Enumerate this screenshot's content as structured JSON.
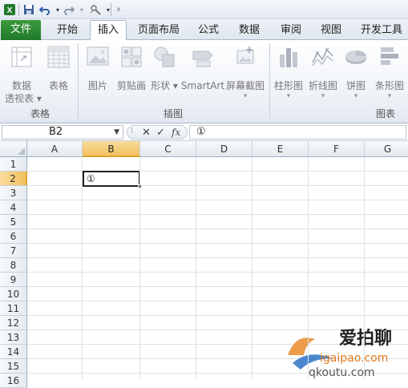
{
  "quick_access": {
    "items": [
      "excel-logo",
      "save-icon",
      "undo-icon",
      "redo-icon",
      "customize-icon"
    ]
  },
  "tabs": [
    {
      "label": "文件",
      "kind": "file"
    },
    {
      "label": "开始"
    },
    {
      "label": "插入",
      "active": true
    },
    {
      "label": "页面布局"
    },
    {
      "label": "公式"
    },
    {
      "label": "数据"
    },
    {
      "label": "审阅"
    },
    {
      "label": "视图"
    },
    {
      "label": "开发工具"
    }
  ],
  "ribbon": {
    "groups": [
      {
        "label": "表格",
        "buttons": [
          {
            "label": "数据\n透视表",
            "icon": "pivot-table-icon",
            "dropdown": true
          },
          {
            "label": "表格",
            "icon": "table-icon"
          }
        ]
      },
      {
        "label": "插图",
        "buttons": [
          {
            "label": "图片",
            "icon": "picture-icon"
          },
          {
            "label": "剪贴画",
            "icon": "clipart-icon"
          },
          {
            "label": "形状",
            "icon": "shapes-icon",
            "dropdown": true
          },
          {
            "label": "SmartArt",
            "icon": "smartart-icon"
          },
          {
            "label": "屏幕截图",
            "icon": "screenshot-icon",
            "dropdown": true
          }
        ]
      },
      {
        "label": "图表",
        "buttons": [
          {
            "label": "柱形图",
            "icon": "column-chart-icon",
            "dropdown": true
          },
          {
            "label": "折线图",
            "icon": "line-chart-icon",
            "dropdown": true
          },
          {
            "label": "饼图",
            "icon": "pie-chart-icon",
            "dropdown": true
          },
          {
            "label": "条形图",
            "icon": "bar-chart-icon",
            "dropdown": true
          }
        ]
      }
    ]
  },
  "formula_bar": {
    "name_box": "B2",
    "fx_label": "fx",
    "content": "①"
  },
  "sheet": {
    "columns": [
      "A",
      "B",
      "C",
      "D",
      "E",
      "F",
      "G"
    ],
    "selected_column": "B",
    "rows": [
      "1",
      "2",
      "3",
      "4",
      "5",
      "6",
      "7",
      "8",
      "9",
      "10",
      "11",
      "12",
      "13",
      "14",
      "15",
      "16"
    ],
    "selected_row": "2",
    "active_cell": {
      "ref": "B2",
      "value": "①"
    }
  },
  "watermark": {
    "line1": "爱拍聊",
    "line2": "igaipao.com",
    "line3": "qkoutu.com"
  },
  "colors": {
    "file_tab": "#2a8a34",
    "selection_header": "#f1c15e",
    "ribbon_bg": "#eef2f7"
  }
}
